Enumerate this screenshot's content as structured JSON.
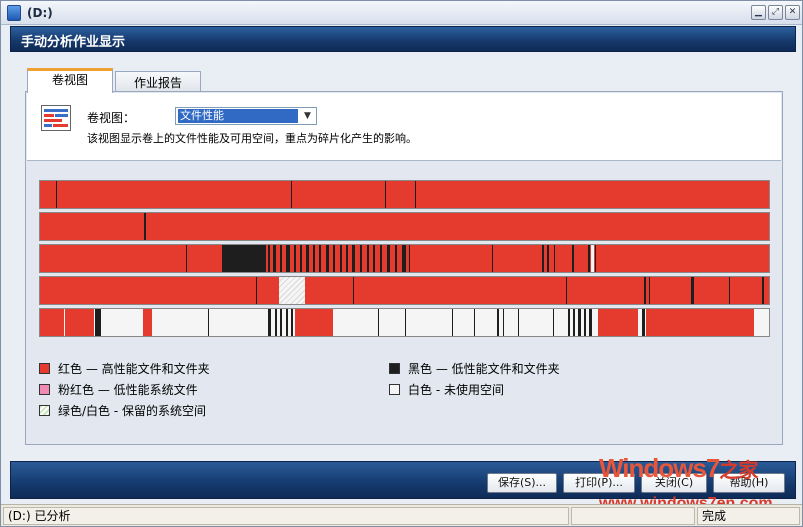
{
  "window": {
    "title": "(D:)"
  },
  "header": {
    "title": "手动分析作业显示"
  },
  "tabs": [
    {
      "label": "卷视图",
      "active": true
    },
    {
      "label": "作业报告",
      "active": false
    }
  ],
  "volume_view": {
    "label": "卷视图：",
    "selected": "文件性能",
    "description": "该视图显示卷上的文件性能及可用空间，重点为碎片化产生的影响。"
  },
  "colors": {
    "red": "#e53a2e",
    "black": "#1e1e1e",
    "pink": "#f08ab4",
    "white": "#f5f5f5",
    "green_white": "#c8e6c0"
  },
  "legend": [
    {
      "color": "#e53a2e",
      "text": "红色 — 高性能文件和文件夹"
    },
    {
      "color": "#f08ab4",
      "text": "粉红色 — 低性能系统文件"
    },
    {
      "color": "#c8e6c0",
      "text": "绿色/白色 - 保留的系统空间"
    },
    {
      "color": "#1e1e1e",
      "text": "黑色 — 低性能文件和文件夹"
    },
    {
      "color": "#f5f5f5",
      "text": "白色 - 未使用空间"
    }
  ],
  "buttons": {
    "save": "保存(S)...",
    "print": "打印(P)...",
    "close": "关闭(C)",
    "help": "帮助(H)"
  },
  "status": {
    "left": "(D:) 已分析",
    "right": "完成"
  },
  "watermark": {
    "line1": "Windows7",
    "line1b": "之家",
    "line2": "www.windows7en.com"
  }
}
